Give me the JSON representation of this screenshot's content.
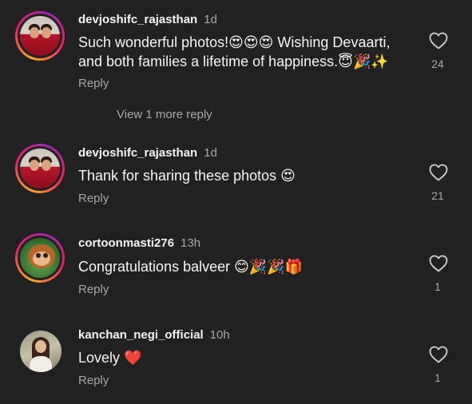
{
  "comments": [
    {
      "username": "devjoshifc_rajasthan",
      "time": "1d",
      "text": "Such wonderful photos!😍😍😍 Wishing Devaarti, and both families a lifetime of happiness.😇🎉✨",
      "reply_label": "Reply",
      "likes": "24",
      "avatar": "couple-photo",
      "story_ring": true
    },
    {
      "username": "devjoshifc_rajasthan",
      "time": "1d",
      "text": "Thank for sharing these photos 😍",
      "reply_label": "Reply",
      "likes": "21",
      "avatar": "couple-photo",
      "story_ring": true
    },
    {
      "username": "cortoonmasti276",
      "time": "13h",
      "text": "Congratulations balveer 😊🎉🎉🎁",
      "reply_label": "Reply",
      "likes": "1",
      "avatar": "monkey-cartoon",
      "story_ring": true
    },
    {
      "username": "kanchan_negi_official",
      "time": "10h",
      "text": "Lovely ❤️",
      "reply_label": "Reply",
      "likes": "1",
      "avatar": "woman-photo",
      "story_ring": false
    }
  ],
  "view_more_replies": "View 1 more reply",
  "icons": {
    "like": "heart-outline-icon"
  },
  "colors": {
    "background": "#212121",
    "text": "#f5f5f5",
    "muted": "#a8a8a8"
  }
}
